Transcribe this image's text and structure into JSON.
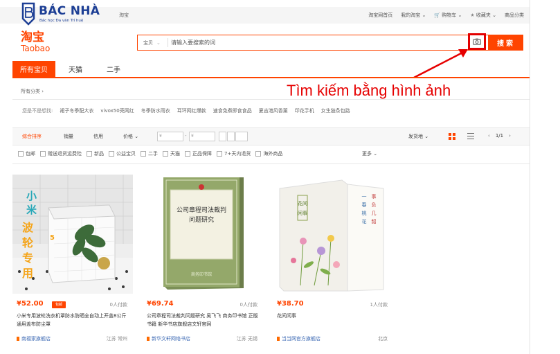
{
  "watermark": {
    "brand": "BÁC NHÀ",
    "tagline": "Bác học Đa văn Trí huệ"
  },
  "topbar": {
    "left_link": "淘宝",
    "links": [
      "淘宝网首页",
      "我的淘宝 ⌄",
      "购物车 ⌄",
      "收藏夹 ⌄",
      "商品分类"
    ]
  },
  "header": {
    "logo_cn": "淘宝",
    "logo_en": "Taobao",
    "search": {
      "category": "宝贝",
      "placeholder": "请输入要搜索的词",
      "button": "搜索"
    }
  },
  "tabs": [
    "所有宝贝",
    "天猫",
    "二手"
  ],
  "edge_char": " ",
  "annotation": "Tìm kiếm bằng hình ảnh",
  "filters": {
    "all_categories": "所有分类 ›",
    "guess_label": "您是不是想找:",
    "guess_items": [
      "裙子冬季配大衣",
      "vivox50壳网红",
      "冬季防水雨衣",
      "耳环网红爆款",
      "速食免煮即食食品",
      "夏吉港风香薰",
      "印花手机",
      "女生链条包路"
    ],
    "sort_items": [
      "综合排序",
      "销量",
      "信用",
      "价格 ⌄"
    ],
    "price_from": "¥",
    "price_to": "¥",
    "ship_from": "发货地 ⌄",
    "pager": {
      "prev": "‹",
      "page": "1/1",
      "next": "›"
    },
    "checkboxes": [
      "包邮",
      "赠送退货运费险",
      "新品",
      "公益宝贝",
      "二手",
      "天猫",
      "正品保障",
      "7+天内退货",
      "海外商品"
    ],
    "more": "更多 ⌄"
  },
  "products": [
    {
      "price": "¥52.00",
      "tag": "包邮",
      "buyers": "0人付款",
      "title": "小米专用波轮洗衣机罩防水防晒全自动上开盖8公斤通用盖布防尘罩",
      "shop": "南福家旗舰店",
      "location": "江苏 常州",
      "image_text": "小米波轮专用"
    },
    {
      "price": "¥69.74",
      "tag": "",
      "buyers": "0人付款",
      "title": "公司章程司法裁判问题研究 吴飞飞 商务印书馆 正版书籍 新华书店旗舰店文轩官网",
      "shop": "新华文轩网络书店",
      "location": "江苏 无锡",
      "image_text": "公司章程司法裁判问题研究"
    },
    {
      "price": "¥38.70",
      "tag": "",
      "buyers": "1人付款",
      "title": "花间闲事",
      "shop": "当当网官方旗舰店",
      "location": "北京",
      "image_text": "花间闲事"
    }
  ],
  "colors": {
    "accent": "#ff4400",
    "annotation": "#e60000",
    "watermark": "#1d3f95"
  }
}
